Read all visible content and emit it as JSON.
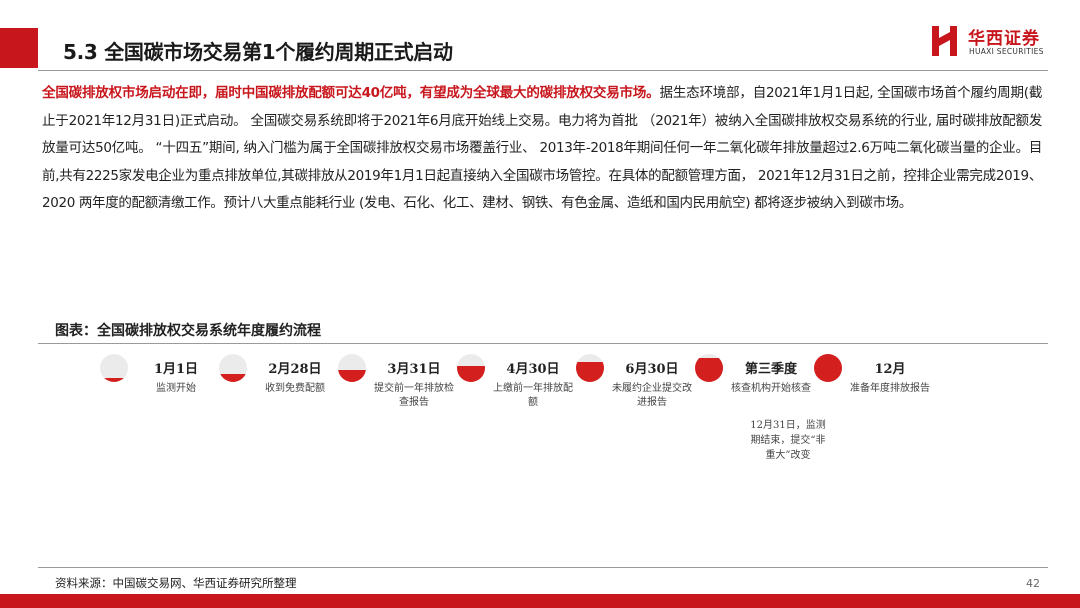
{
  "header": {
    "title": "5.3 全国碳市场交易第1个履约周期正式启动",
    "logo_cn": "华西证券",
    "logo_en": "HUAXI SECURITIES"
  },
  "body": {
    "highlight": "全国碳排放权市场启动在即，届时中国碳排放配额可达40亿吨，有望成为全球最大的碳排放权交易市场。",
    "text": "据生态环境部，自2021年1月1日起, 全国碳市场首个履约周期(截止于2021年12月31日)正式启动。 全国碳交易系统即将于2021年6月底开始线上交易。电力将为首批 （2021年）被纳入全国碳排放权交易系统的行业, 届时碳排放配额发放量可达50亿吨。 “十四五”期间, 纳入门槛为属于全国碳排放权交易市场覆盖行业、 2013年-2018年期间任何一年二氧化碳年排放量超过2.6万吨二氧化碳当量的企业。目前,共有2225家发电企业为重点排放单位,其碳排放从2019年1月1日起直接纳入全国碳市场管控。在具体的配额管理方面， 2021年12月31日之前，控排企业需完成2019、2020 两年度的配额清缴工作。预计八大重点能耗行业 (发电、石化、化工、建材、钢铁、有色金属、造纸和国内民用航空) 都将逐步被纳入到碳市场。"
  },
  "figure": {
    "title": "图表：全国碳排放权交易系统年度履约流程",
    "steps": [
      {
        "label": "1月1日",
        "desc": "监测开始",
        "progress": 0.14
      },
      {
        "label": "2月28日",
        "desc": "收到免费配额",
        "progress": 0.29
      },
      {
        "label": "3月31日",
        "desc": "提交前一年排放检查报告",
        "progress": 0.43
      },
      {
        "label": "4月30日",
        "desc": "上缴前一年排放配额",
        "progress": 0.57
      },
      {
        "label": "6月30日",
        "desc": "未履约企业提交改进报告",
        "progress": 0.71
      },
      {
        "label": "第三季度",
        "desc": "核查机构开始核查",
        "progress": 0.86
      },
      {
        "label": "12月",
        "desc": "准备年度排放报告",
        "progress": 1.0
      }
    ],
    "extra_note": "12月31日，监测期结束，提交“非重大”改变"
  },
  "footer": {
    "source": "资料来源：中国碳交易网、华西证券研究所整理",
    "page": "42"
  },
  "colors": {
    "accent": "#c8161d",
    "progress_fill": "#d41f1f",
    "progress_empty": "#ebebeb"
  }
}
